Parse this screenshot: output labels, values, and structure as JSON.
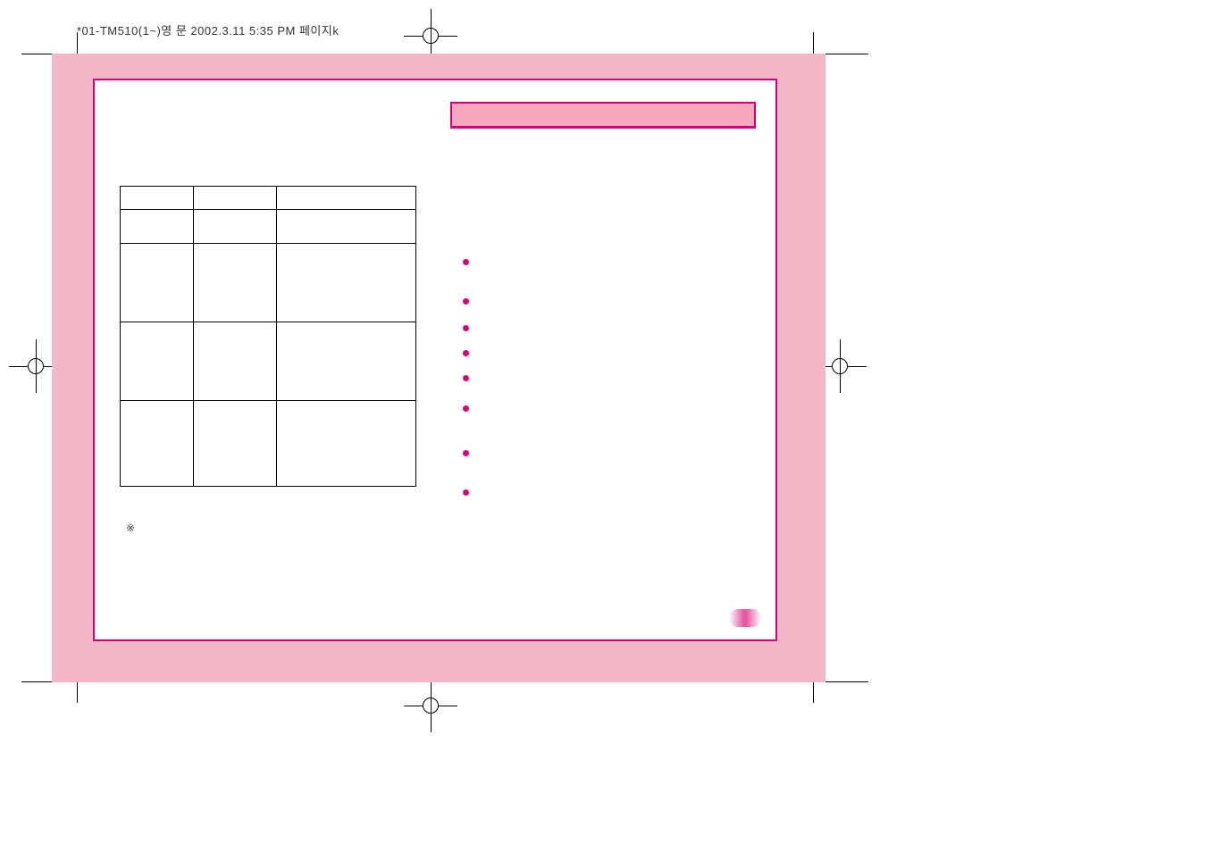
{
  "header_text": "*01-TM510(1~)영 문  2002.3.11 5:35 PM  페이지k",
  "title_bar": "",
  "table": {
    "rows": [
      [
        "",
        "",
        ""
      ],
      [
        "",
        "",
        ""
      ],
      [
        "",
        "",
        ""
      ],
      [
        "",
        "",
        ""
      ],
      [
        "",
        "",
        ""
      ]
    ]
  },
  "footnote_mark": "※",
  "bullets": [
    "",
    "",
    "",
    "",
    "",
    "",
    "",
    ""
  ],
  "page_number": ""
}
